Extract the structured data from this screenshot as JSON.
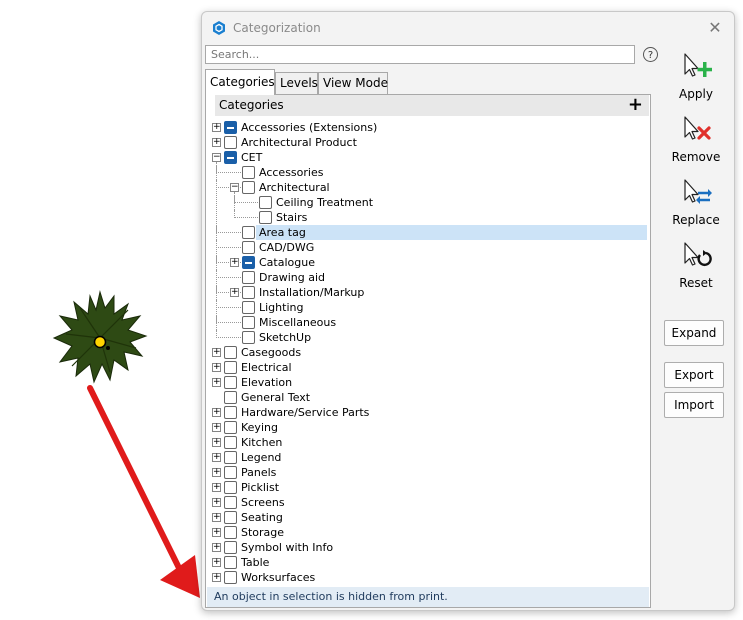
{
  "window": {
    "title": "Categorization"
  },
  "search": {
    "placeholder": "Search...",
    "help": "?"
  },
  "tabs": [
    {
      "label": "Categories"
    },
    {
      "label": "Levels"
    },
    {
      "label": "View Mode"
    }
  ],
  "tree": {
    "header": "Categories",
    "add": "+"
  },
  "nodes": [
    {
      "label": "Accessories (Extensions)",
      "level": 0,
      "expander": "+",
      "state": "partial"
    },
    {
      "label": "Architectural Product",
      "level": 0,
      "expander": "+",
      "state": "unchecked"
    },
    {
      "label": "CET",
      "level": 0,
      "expander": "-",
      "state": "partial"
    },
    {
      "label": "Accessories",
      "level": 1,
      "expander": "",
      "state": "unchecked"
    },
    {
      "label": "Architectural",
      "level": 1,
      "expander": "-",
      "state": "unchecked"
    },
    {
      "label": "Ceiling Treatment",
      "level": 2,
      "expander": "",
      "state": "unchecked"
    },
    {
      "label": "Stairs",
      "level": 2,
      "expander": "",
      "state": "unchecked"
    },
    {
      "label": "Area tag",
      "level": 1,
      "expander": "",
      "state": "unchecked",
      "selected": true
    },
    {
      "label": "CAD/DWG",
      "level": 1,
      "expander": "",
      "state": "unchecked"
    },
    {
      "label": "Catalogue",
      "level": 1,
      "expander": "+",
      "state": "partial"
    },
    {
      "label": "Drawing aid",
      "level": 1,
      "expander": "",
      "state": "unchecked"
    },
    {
      "label": "Installation/Markup",
      "level": 1,
      "expander": "+",
      "state": "unchecked"
    },
    {
      "label": "Lighting",
      "level": 1,
      "expander": "",
      "state": "unchecked"
    },
    {
      "label": "Miscellaneous",
      "level": 1,
      "expander": "",
      "state": "unchecked"
    },
    {
      "label": "SketchUp",
      "level": 1,
      "expander": "",
      "state": "unchecked"
    },
    {
      "label": "Casegoods",
      "level": 0,
      "expander": "+",
      "state": "unchecked"
    },
    {
      "label": "Electrical",
      "level": 0,
      "expander": "+",
      "state": "unchecked"
    },
    {
      "label": "Elevation",
      "level": 0,
      "expander": "+",
      "state": "unchecked"
    },
    {
      "label": "General Text",
      "level": 0,
      "expander": "",
      "state": "unchecked"
    },
    {
      "label": "Hardware/Service Parts",
      "level": 0,
      "expander": "+",
      "state": "unchecked"
    },
    {
      "label": "Keying",
      "level": 0,
      "expander": "+",
      "state": "unchecked"
    },
    {
      "label": "Kitchen",
      "level": 0,
      "expander": "+",
      "state": "unchecked"
    },
    {
      "label": "Legend",
      "level": 0,
      "expander": "+",
      "state": "unchecked"
    },
    {
      "label": "Panels",
      "level": 0,
      "expander": "+",
      "state": "unchecked"
    },
    {
      "label": "Picklist",
      "level": 0,
      "expander": "+",
      "state": "unchecked"
    },
    {
      "label": "Screens",
      "level": 0,
      "expander": "+",
      "state": "unchecked"
    },
    {
      "label": "Seating",
      "level": 0,
      "expander": "+",
      "state": "unchecked"
    },
    {
      "label": "Storage",
      "level": 0,
      "expander": "+",
      "state": "unchecked"
    },
    {
      "label": "Symbol with Info",
      "level": 0,
      "expander": "+",
      "state": "unchecked"
    },
    {
      "label": "Table",
      "level": 0,
      "expander": "+",
      "state": "unchecked"
    },
    {
      "label": "Worksurfaces",
      "level": 0,
      "expander": "+",
      "state": "unchecked"
    }
  ],
  "status": "An object in selection is hidden from print.",
  "actions": {
    "apply": "Apply",
    "remove": "Remove",
    "replace": "Replace",
    "reset": "Reset"
  },
  "buttons": {
    "expand": "Expand",
    "export": "Export",
    "import": "Import"
  },
  "colors": {
    "accent": "#1a5fa8",
    "plant": "#2e4a14",
    "arrow": "#e01b1b",
    "apply": "#2ab24a",
    "remove": "#e0302b",
    "replace": "#1a6fc0",
    "selection": "#cce3f7"
  }
}
